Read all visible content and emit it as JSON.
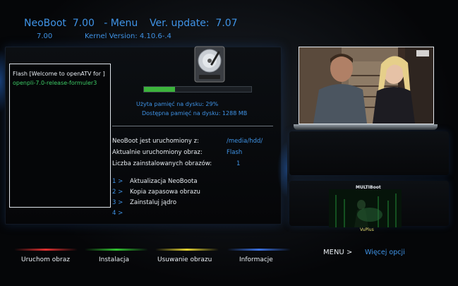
{
  "header": {
    "title": "NeoBoot  7.00   - Menu",
    "update": "Ver. update:  7.07",
    "version": "7.00",
    "kernel": "Kernel Version: 4.10.6-.4"
  },
  "image_list": {
    "items": [
      {
        "label": "Flash [Welcome to openATV for ]",
        "selected": true
      },
      {
        "label": "openpli-7.0-release-formuler3",
        "selected": false
      }
    ]
  },
  "disk": {
    "usage_percent": 29,
    "used_label": "Użyta pamięć na dysku: 29%",
    "free_label": "Dostępna pamięć na dysku: 1288 MB"
  },
  "status": {
    "rows": [
      {
        "label": "NeoBoot jest uruchomiony z:",
        "value": "/media/hdd/"
      },
      {
        "label": "Aktualnie uruchomiony obraz:",
        "value": "Flash"
      },
      {
        "label": "Liczba zainstalowanych obrazów:",
        "value": "1"
      }
    ]
  },
  "menu": {
    "items": [
      {
        "num": "1 >",
        "label": "Aktualizacja NeoBoota"
      },
      {
        "num": "2 >",
        "label": "Kopia zapasowa obrazu"
      },
      {
        "num": "3 >",
        "label": "Zainstaluj jądro"
      },
      {
        "num": "4 >",
        "label": ""
      }
    ]
  },
  "preview": {
    "multiboot_title": "MULTIBoot",
    "multiboot_sub": "VuPlus"
  },
  "footer": {
    "buttons": [
      {
        "label": "Uruchom obraz",
        "color": "#e03030"
      },
      {
        "label": "Instalacja",
        "color": "#30c030"
      },
      {
        "label": "Usuwanie obrazu",
        "color": "#e0d030"
      },
      {
        "label": "Informacje",
        "color": "#3a70e0"
      }
    ],
    "menu_key": "MENU >",
    "menu_text": "Więcej opcji"
  }
}
